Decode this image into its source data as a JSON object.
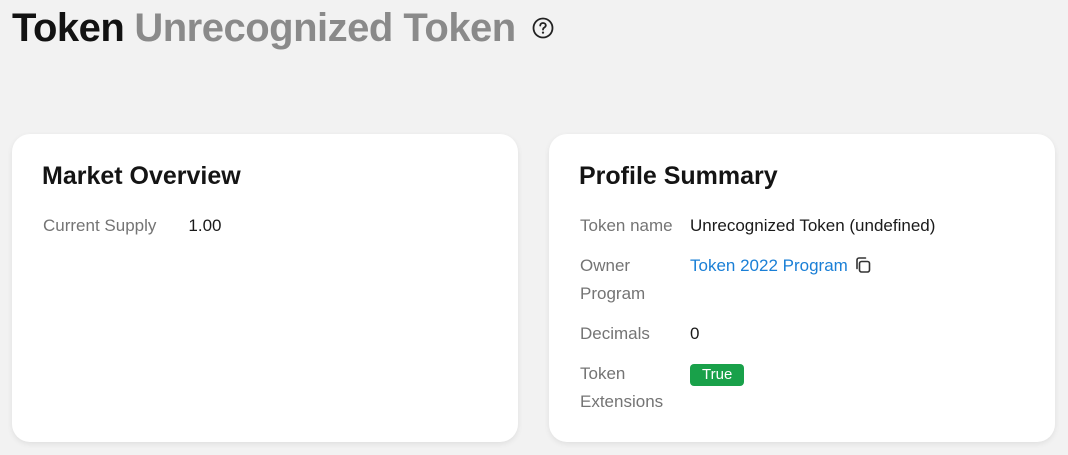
{
  "header": {
    "title": "Token",
    "subtitle": "Unrecognized Token",
    "help_icon": "question-circle-icon"
  },
  "market_overview": {
    "title": "Market Overview",
    "rows": [
      {
        "label": "Current Supply",
        "value": "1.00"
      }
    ]
  },
  "profile_summary": {
    "title": "Profile Summary",
    "token_name_label": "Token name",
    "token_name_value": "Unrecognized Token (undefined)",
    "owner_program_label": "Owner Program",
    "owner_program_value": "Token 2022 Program",
    "owner_program_icon": "copy-icon",
    "decimals_label": "Decimals",
    "decimals_value": "0",
    "token_extensions_label": "Token Extensions",
    "token_extensions_value": "True"
  },
  "colors": {
    "link": "#1a7fd6",
    "badge_success": "#19a14a",
    "muted_title": "#8a8a8a"
  }
}
